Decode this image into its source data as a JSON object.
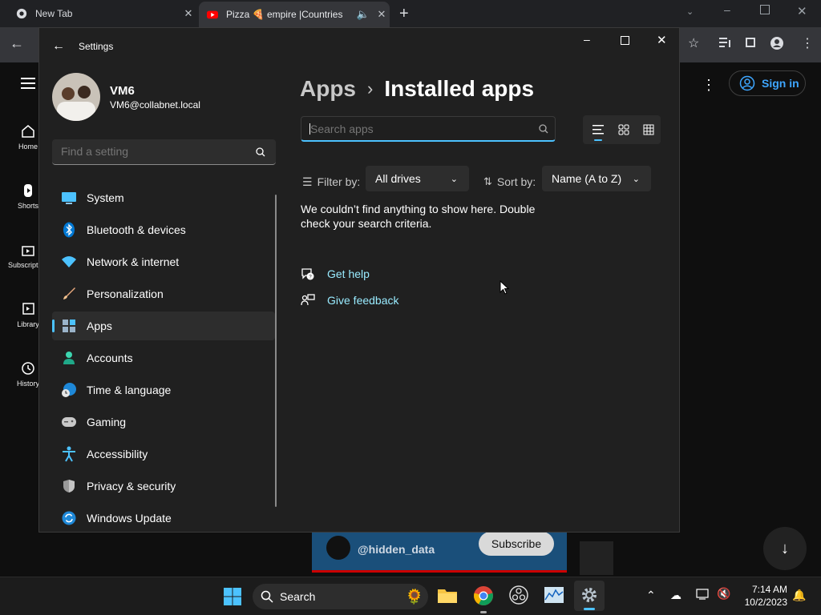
{
  "browser": {
    "tabs": [
      {
        "title": "New Tab",
        "close": "✕"
      },
      {
        "title": "Pizza 🍕 empire |Countries",
        "close": "✕"
      }
    ],
    "new_tab": "+"
  },
  "youtube": {
    "sign_in": "Sign in",
    "nav": [
      {
        "label": "Home"
      },
      {
        "label": "Shorts"
      },
      {
        "label": "Subscriptions"
      },
      {
        "label": "Library"
      },
      {
        "label": "History"
      }
    ],
    "mini_player": {
      "channel": "@hidden_data",
      "subscribe": "Subscribe"
    }
  },
  "settings": {
    "window_title": "Settings",
    "user": {
      "name": "VM6",
      "email": "VM6@collabnet.local"
    },
    "search_placeholder": "Find a setting",
    "nav": [
      {
        "label": "System",
        "icon": "monitor-icon"
      },
      {
        "label": "Bluetooth & devices",
        "icon": "bluetooth-icon"
      },
      {
        "label": "Network & internet",
        "icon": "wifi-icon"
      },
      {
        "label": "Personalization",
        "icon": "brush-icon"
      },
      {
        "label": "Apps",
        "icon": "apps-icon",
        "selected": true
      },
      {
        "label": "Accounts",
        "icon": "person-icon"
      },
      {
        "label": "Time & language",
        "icon": "globe-clock-icon"
      },
      {
        "label": "Gaming",
        "icon": "gamepad-icon"
      },
      {
        "label": "Accessibility",
        "icon": "accessibility-icon"
      },
      {
        "label": "Privacy & security",
        "icon": "shield-icon"
      },
      {
        "label": "Windows Update",
        "icon": "refresh-icon"
      }
    ],
    "breadcrumb": {
      "parent": "Apps",
      "separator": "›",
      "current": "Installed apps"
    },
    "apps_search_placeholder": "Search apps",
    "filter": {
      "label": "Filter by:",
      "value": "All drives"
    },
    "sort": {
      "label": "Sort by:",
      "value": "Name (A to Z)"
    },
    "empty_message": "We couldn’t find anything to show here. Double check your search criteria.",
    "links": {
      "help": "Get help",
      "feedback": "Give feedback"
    }
  },
  "taskbar": {
    "search_label": "Search",
    "time": "7:14 AM",
    "date": "10/2/2023"
  },
  "colors": {
    "accent": "#4cc2ff",
    "link": "#99ebff",
    "window_bg": "#202020"
  }
}
